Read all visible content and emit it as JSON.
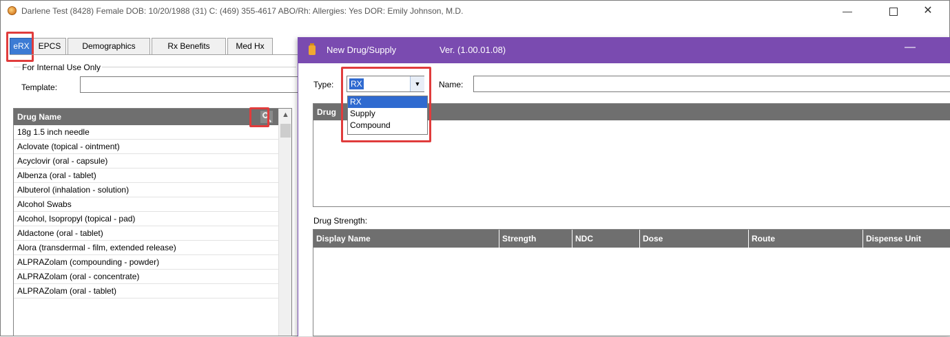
{
  "window": {
    "title": "Darlene  Test (8428) Female  DOB: 10/20/1988 (31) C: (469) 355-4617  ABO/Rh:   Allergies: Yes  DOR: Emily Johnson, M.D.",
    "controls": {
      "minimize": "—",
      "close": "✕"
    }
  },
  "tabs": [
    "eRX",
    "EPCS",
    "Demographics",
    "Rx Benefits",
    "Med Hx"
  ],
  "panel": {
    "group_label": "For Internal Use Only",
    "template_label": "Template:",
    "template_value": ""
  },
  "drug_list": {
    "header": "Drug Name",
    "items": [
      "18g 1.5 inch needle",
      "Aclovate (topical - ointment)",
      "Acyclovir (oral - capsule)",
      "Albenza (oral - tablet)",
      "Albuterol (inhalation - solution)",
      "Alcohol Swabs",
      "Alcohol, Isopropyl (topical - pad)",
      "Aldactone (oral - tablet)",
      "Alora (transdermal - film, extended release)",
      "ALPRAZolam (compounding - powder)",
      "ALPRAZolam (oral - concentrate)",
      "ALPRAZolam (oral - tablet)"
    ]
  },
  "dialog": {
    "title": "New Drug/Supply",
    "version": "Ver. (1.00.01.08)",
    "minimize": "—",
    "type_label": "Type:",
    "type_value": "RX",
    "type_options": [
      "RX",
      "Supply",
      "Compound"
    ],
    "name_label": "Name:",
    "name_value": "",
    "grid_header": "Drug",
    "strength_label": "Drug Strength:",
    "strength_columns": [
      "Display Name",
      "Strength",
      "NDC",
      "Dose",
      "Route",
      "Dispense Unit"
    ]
  },
  "colors": {
    "accent_purple": "#7a4bb0",
    "selection_blue": "#2f6ad0",
    "highlight_red": "#e03c3c",
    "header_gray": "#6f6f6f"
  }
}
